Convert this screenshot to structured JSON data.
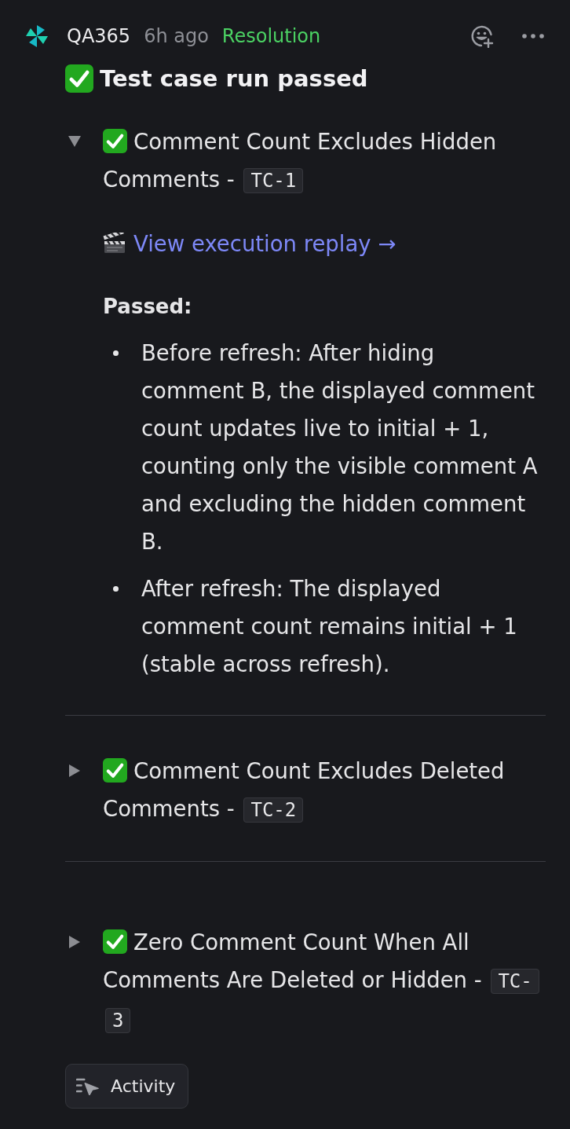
{
  "post": {
    "author": "QA365",
    "time": "6h ago",
    "tag": "Resolution"
  },
  "title": {
    "passed": true,
    "text": "Test case run passed"
  },
  "cases": [
    {
      "passed": true,
      "expanded": true,
      "title": "Comment Count Excludes Hidden Comments -",
      "code": "TC-1",
      "replay_link": "View execution replay →",
      "result_label": "Passed:",
      "findings": [
        "Before refresh: After hiding comment B, the displayed comment count updates live to initial + 1, counting only the visible comment A and excluding the hidden comment B.",
        "After refresh: The displayed comment count remains initial + 1 (stable across refresh)."
      ]
    },
    {
      "passed": true,
      "expanded": false,
      "title": "Comment Count Excludes Deleted Comments -",
      "code": "TC-2"
    },
    {
      "passed": true,
      "expanded": false,
      "title": "Zero Comment Count When All Comments Are Deleted or Hidden -",
      "code": "TC-3"
    }
  ],
  "activity_button": {
    "label": "Activity"
  }
}
